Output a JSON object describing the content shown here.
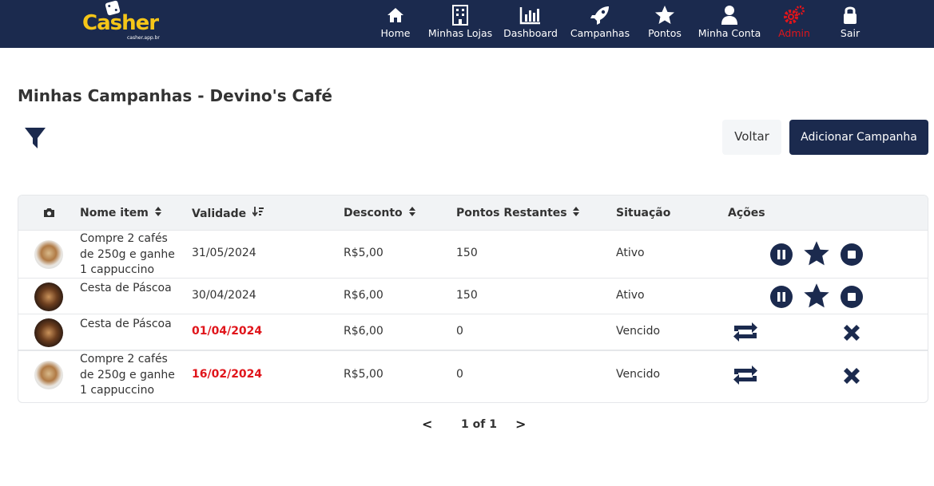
{
  "brand": {
    "name": "Casher",
    "domain": "casher.app.br"
  },
  "nav": [
    {
      "label": "Home",
      "icon": "home-icon"
    },
    {
      "label": "Minhas Lojas",
      "icon": "building-icon"
    },
    {
      "label": "Dashboard",
      "icon": "bar-chart-icon"
    },
    {
      "label": "Campanhas",
      "icon": "rocket-icon"
    },
    {
      "label": "Pontos",
      "icon": "star-icon"
    },
    {
      "label": "Minha Conta",
      "icon": "user-icon"
    },
    {
      "label": "Admin",
      "icon": "gears-icon",
      "color": "#e0151b"
    },
    {
      "label": "Sair",
      "icon": "lock-icon"
    }
  ],
  "page": {
    "title": "Minhas Campanhas - Devino's Café",
    "back_label": "Voltar",
    "add_label": "Adicionar Campanha"
  },
  "table": {
    "headers": {
      "photo": "camera-icon",
      "name": "Nome item",
      "validity": "Validade",
      "discount": "Desconto",
      "points": "Pontos Restantes",
      "status": "Situação",
      "actions": "Ações"
    },
    "rows": [
      {
        "name": "Compre 2 cafés de 250g e ganhe 1 cappuccino",
        "validity": "31/05/2024",
        "discount": "R$5,00",
        "points": "150",
        "status": "Ativo",
        "expired": false,
        "thumb": "coffee"
      },
      {
        "name": "Cesta de Páscoa",
        "validity": "30/04/2024",
        "discount": "R$6,00",
        "points": "150",
        "status": "Ativo",
        "expired": false,
        "thumb": "pascoa"
      },
      {
        "name": "Cesta de Páscoa",
        "validity": "01/04/2024",
        "discount": "R$6,00",
        "points": "0",
        "status": "Vencido",
        "expired": true,
        "thumb": "pascoa"
      },
      {
        "name": "Compre 2 cafés de 250g e ganhe 1 cappuccino",
        "validity": "16/02/2024",
        "discount": "R$5,00",
        "points": "0",
        "status": "Vencido",
        "expired": true,
        "thumb": "coffee"
      }
    ]
  },
  "pagination": {
    "text": "1 of 1",
    "prev": "<",
    "next": ">"
  },
  "colors": {
    "navy": "#1b2a4e",
    "danger": "#e0151b",
    "logo": "#f5c518"
  }
}
